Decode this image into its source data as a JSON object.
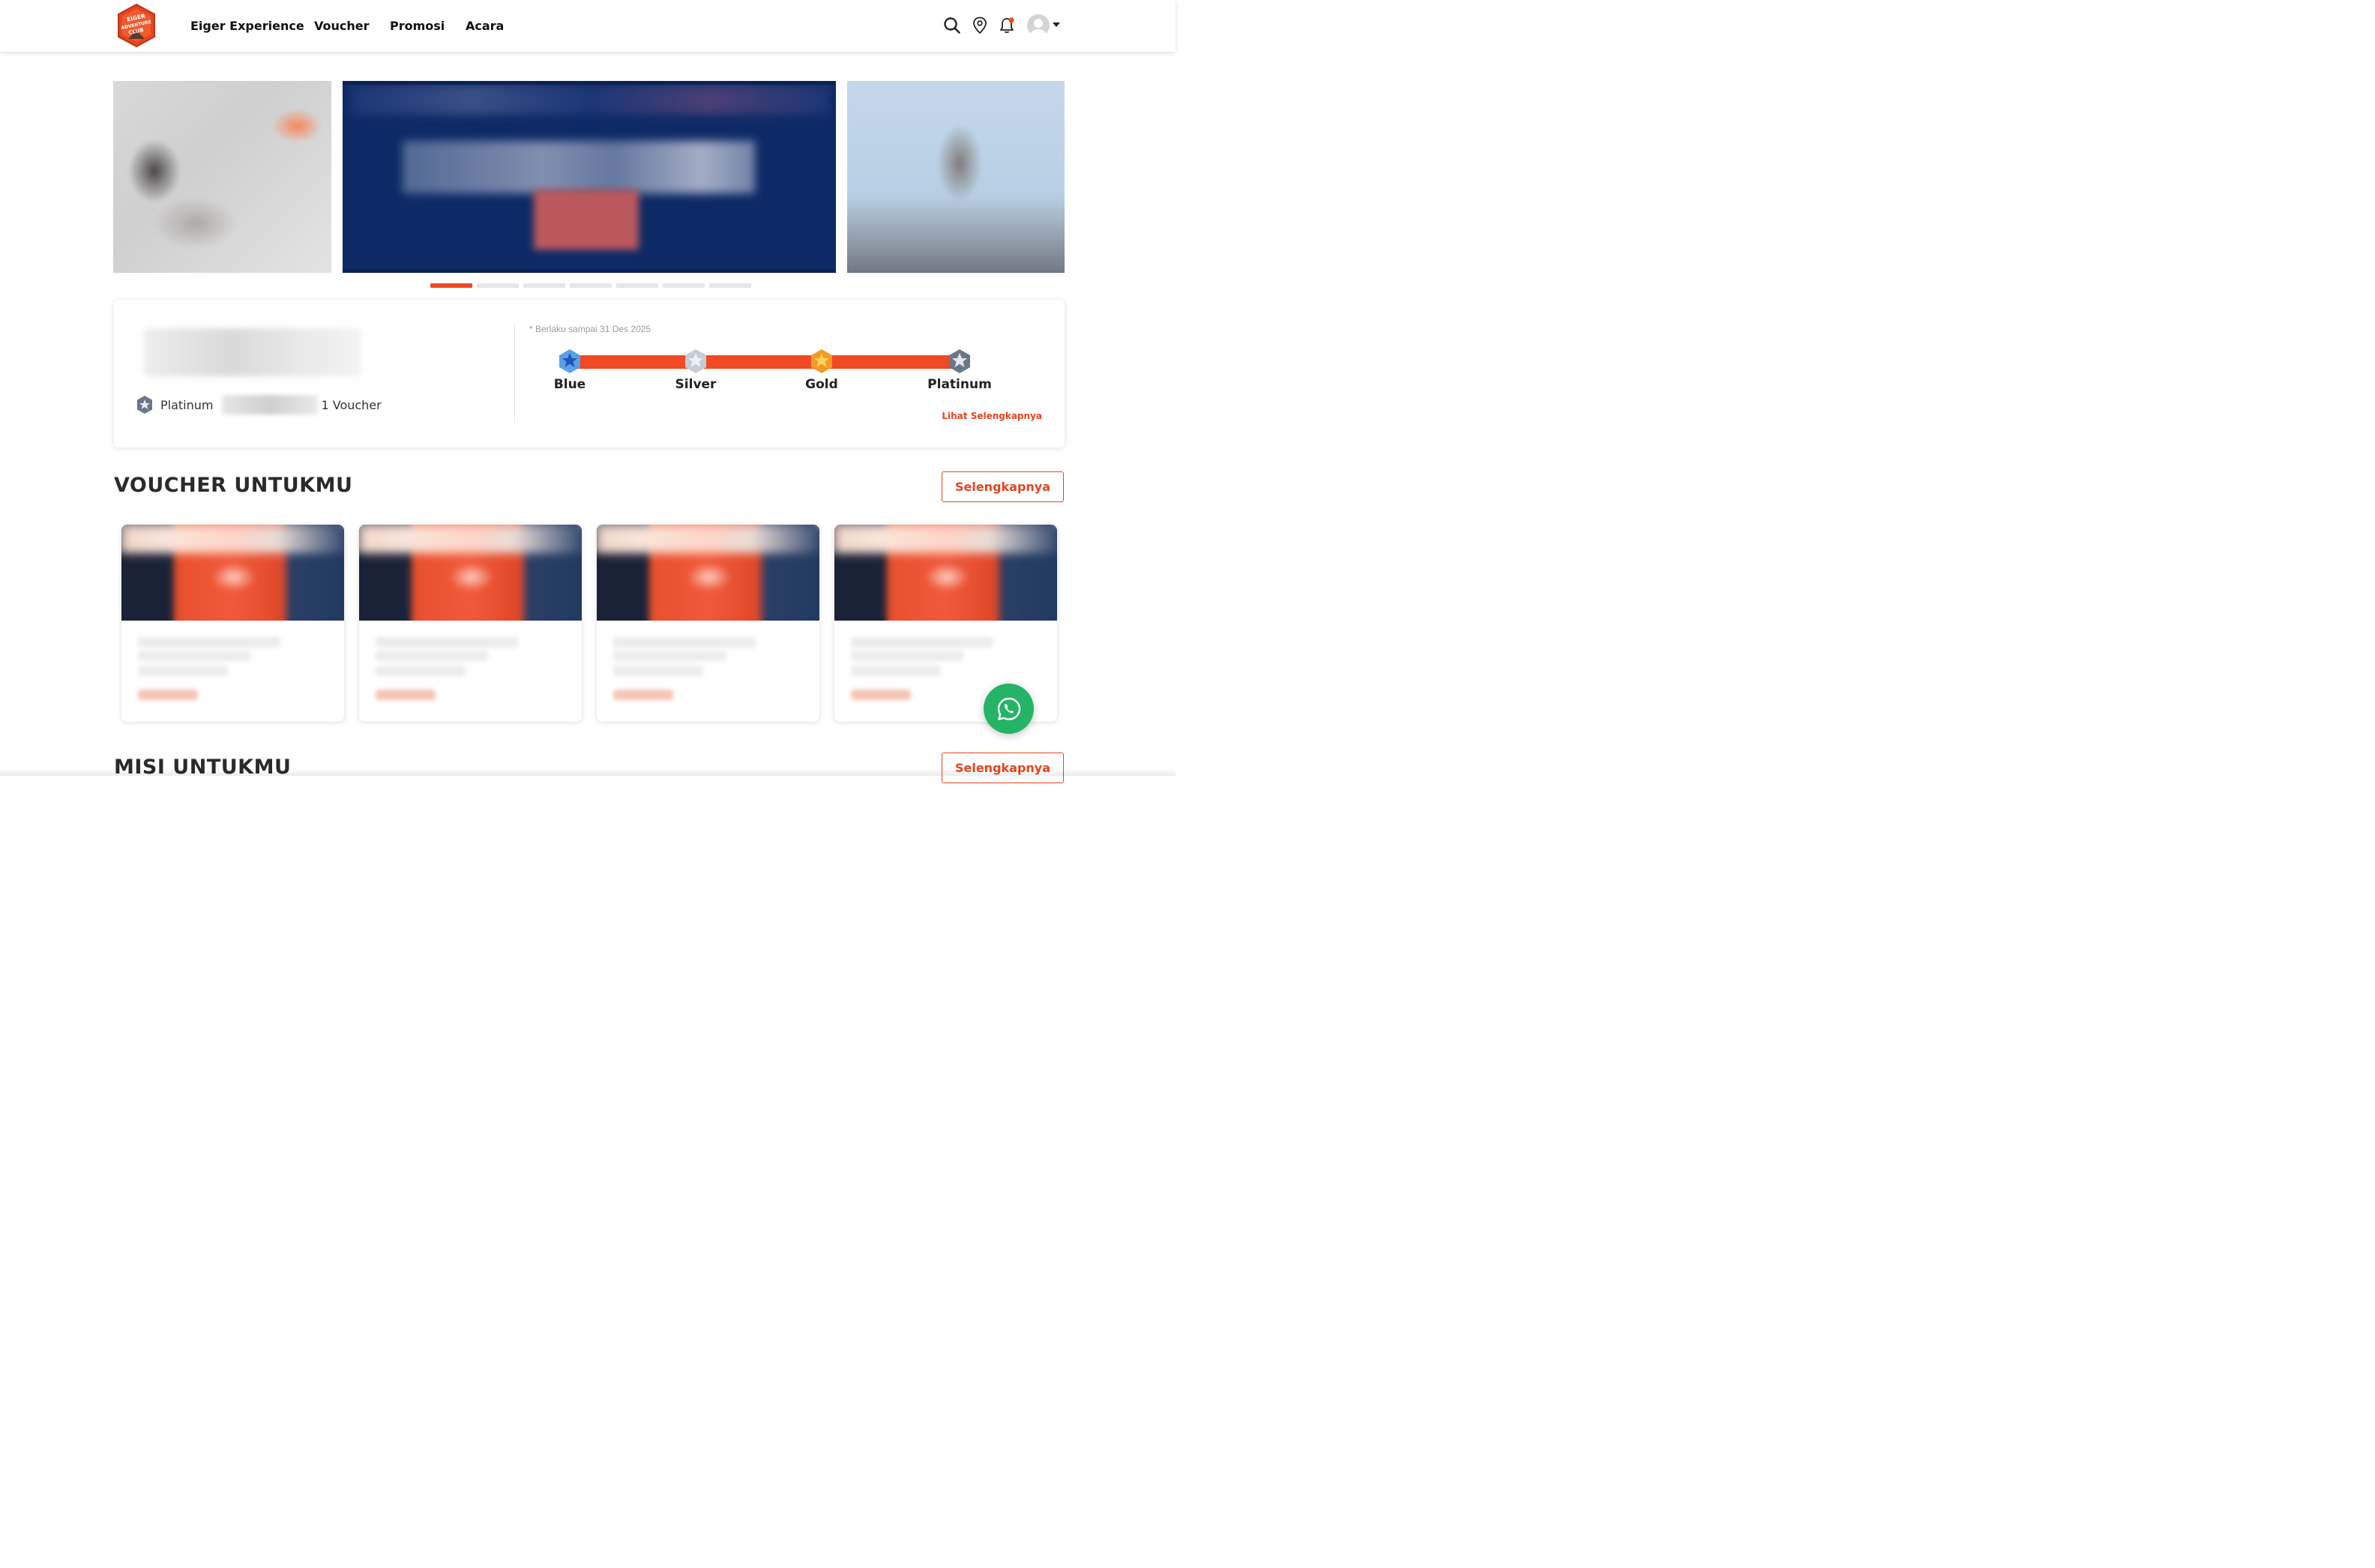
{
  "header": {
    "logo_text": "EIGER ADVENTURE CLUB",
    "nav": [
      "Eiger Experience",
      "Voucher",
      "Promosi",
      "Acara"
    ],
    "icons": [
      "search-icon",
      "location-pin-icon",
      "bell-icon",
      "avatar",
      "caret-down-icon"
    ],
    "notification_dot_color": "#f04923"
  },
  "carousel": {
    "slide_count": 7,
    "active_index": 0,
    "active_color": "#f04923"
  },
  "member": {
    "tier_name": "Platinum",
    "voucher_count_text": "1 Voucher",
    "validity_text": "* Berlaku sampai 31 Des 2025",
    "tiers": [
      "Blue",
      "Silver",
      "Gold",
      "Platinum"
    ],
    "tier_colors": [
      "#2f6fd6",
      "#b9c3cf",
      "#f2a22a",
      "#6b7788"
    ],
    "progress_color": "#f04923",
    "see_more_label": "Lihat Selengkapnya"
  },
  "vouchers_section": {
    "title": "VOUCHER UNTUKMU",
    "more_label": "Selengkapnya",
    "card_count": 4
  },
  "missions_section": {
    "title": "MISI UNTUKMU",
    "more_label": "Selengkapnya"
  },
  "whatsapp": {
    "icon": "whatsapp-icon",
    "color": "#25b466"
  },
  "brand": {
    "accent": "#e6441f"
  }
}
